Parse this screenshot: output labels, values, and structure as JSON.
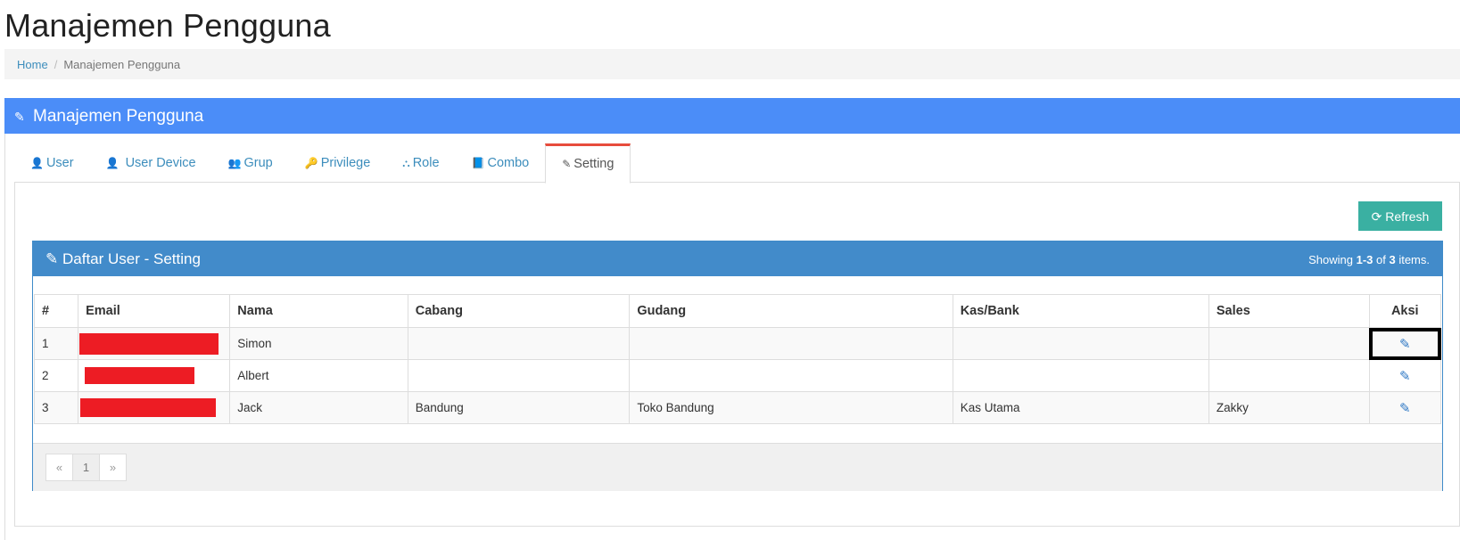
{
  "page": {
    "title": "Manajemen Pengguna"
  },
  "breadcrumb": {
    "home": "Home",
    "separator": "/",
    "current": "Manajemen Pengguna"
  },
  "panel": {
    "icon": "pencil-icon",
    "title": "Manajemen Pengguna",
    "accent": "#4b8df8"
  },
  "tabs": [
    {
      "icon": "user-icon",
      "glyph": "👤",
      "label": "User"
    },
    {
      "icon": "user-icon",
      "glyph": "👤",
      "label": "User Device"
    },
    {
      "icon": "users-icon",
      "glyph": "👥",
      "label": "Grup"
    },
    {
      "icon": "key-icon",
      "glyph": "🔑",
      "label": "Privilege"
    },
    {
      "icon": "sitemap-icon",
      "glyph": "⛬",
      "label": "Role"
    },
    {
      "icon": "book-icon",
      "glyph": "📘",
      "label": "Combo"
    },
    {
      "icon": "edit-icon",
      "glyph": "✎",
      "label": "Setting",
      "active": true
    }
  ],
  "toolbar": {
    "refresh_label": "Refresh",
    "refresh_glyph": "⟳",
    "refresh_color": "#3ab0a2"
  },
  "grid": {
    "icon": "edit-icon",
    "title": "Daftar User - Setting",
    "summary": {
      "prefix": "Showing ",
      "range": "1-3",
      "mid": " of ",
      "total": "3",
      "suffix": " items."
    },
    "columns": [
      "#",
      "Email",
      "Nama",
      "Cabang",
      "Gudang",
      "Kas/Bank",
      "Sales",
      "Aksi"
    ],
    "rows": [
      {
        "no": "1",
        "email_redacted": true,
        "nama": "Simon",
        "cabang": "",
        "gudang": "",
        "kas_bank": "",
        "sales": ""
      },
      {
        "no": "2",
        "email_redacted": true,
        "nama": "Albert",
        "cabang": "",
        "gudang": "",
        "kas_bank": "",
        "sales": ""
      },
      {
        "no": "3",
        "email_redacted": true,
        "nama": "Jack",
        "cabang": "Bandung",
        "gudang": "Toko Bandung",
        "kas_bank": "Kas Utama",
        "sales": "Zakky"
      }
    ],
    "pager": {
      "prev": "«",
      "page": "1",
      "next": "»"
    }
  }
}
